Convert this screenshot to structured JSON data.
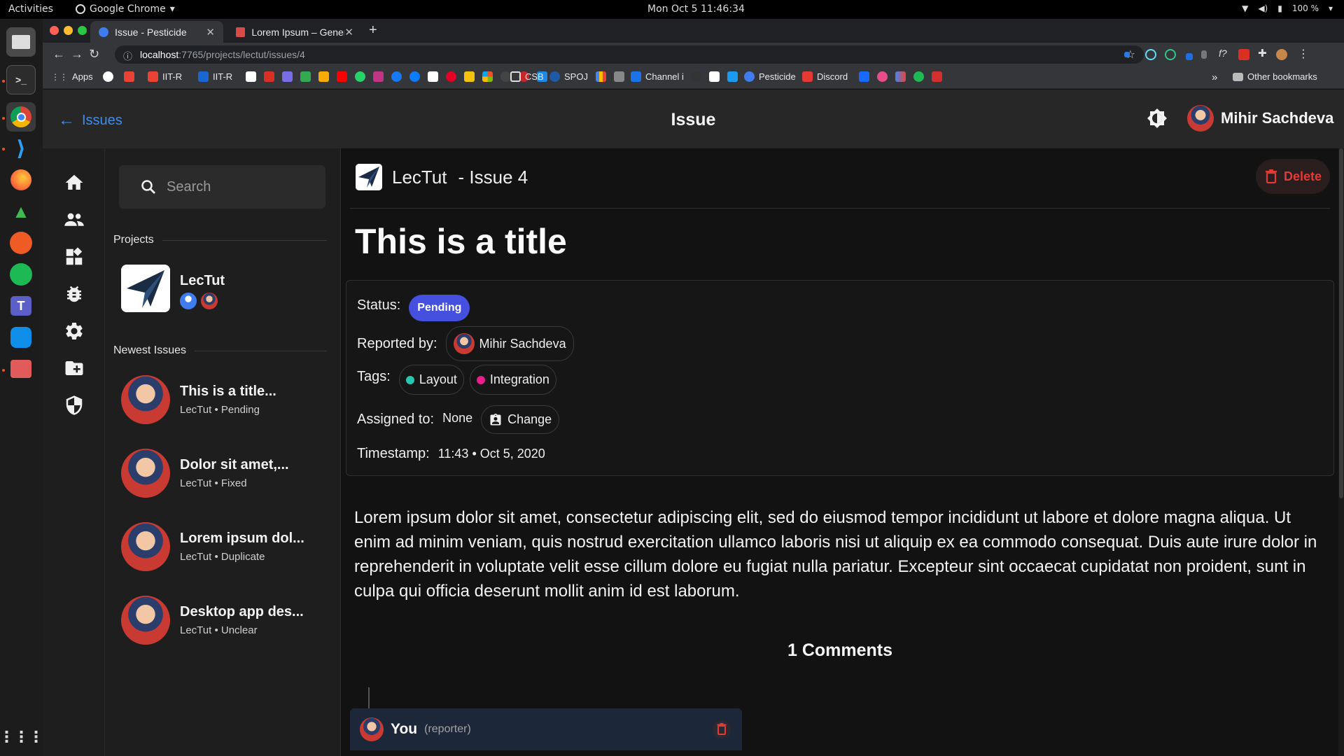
{
  "os": {
    "activities": "Activities",
    "app_name": "Google Chrome",
    "clock": "Mon Oct 5  11:46:34",
    "battery": "100 %"
  },
  "browser": {
    "tabs": [
      {
        "label": "Issue - Pesticide",
        "active": true
      },
      {
        "label": "Lorem Ipsum – Generator",
        "active": false
      }
    ],
    "url_host": "localhost",
    "url_path": ":7765/projects/lectut/issues/4",
    "bookmarks": [
      "Apps",
      "IIT-R",
      "IIT-R",
      "CSB",
      "SPOJ",
      "Channel i",
      "Pesticide",
      "Discord"
    ],
    "overflow": "»",
    "other_bookmarks": "Other bookmarks"
  },
  "header": {
    "back_label": "Issues",
    "page_title": "Issue",
    "user_name": "Mihir Sachdeva"
  },
  "sidebar": {
    "search_placeholder": "Search",
    "projects_heading": "Projects",
    "project": {
      "name": "LecTut"
    },
    "newest_heading": "Newest Issues",
    "issues": [
      {
        "title": "This is a title...",
        "subtitle": "LecTut • Pending"
      },
      {
        "title": "Dolor sit amet,...",
        "subtitle": "LecTut • Fixed"
      },
      {
        "title": "Lorem ipsum dol...",
        "subtitle": "LecTut • Duplicate"
      },
      {
        "title": "Desktop app des...",
        "subtitle": "LecTut • Unclear"
      }
    ]
  },
  "issue": {
    "project_name": "LecTut",
    "issue_number": "- Issue 4",
    "delete_label": "Delete",
    "title": "This is a title",
    "status_label": "Status:",
    "status_value": "Pending",
    "reported_label": "Reported by:",
    "reporter": "Mihir Sachdeva",
    "tags_label": "Tags:",
    "tags": [
      {
        "name": "Layout",
        "color": "#26c6b0"
      },
      {
        "name": "Integration",
        "color": "#e91e8c"
      }
    ],
    "assigned_label": "Assigned to:",
    "assigned_value": "None",
    "change_label": "Change",
    "timestamp_label": "Timestamp:",
    "timestamp_value": "11:43 • Oct 5, 2020",
    "description": "Lorem ipsum dolor sit amet, consectetur adipiscing elit, sed do eiusmod tempor incididunt ut labore et dolore magna aliqua. Ut enim ad minim veniam, quis nostrud exercitation ullamco laboris nisi ut aliquip ex ea commodo consequat. Duis aute irure dolor in reprehenderit in voluptate velit esse cillum dolore eu fugiat nulla pariatur. Excepteur sint occaecat cupidatat non proident, sunt in culpa qui officia deserunt mollit anim id est laborum.",
    "comments_title": "1 Comments",
    "comment": {
      "author": "You",
      "role": "(reporter)"
    }
  },
  "colors": {
    "accent": "#3f8cf0",
    "pending": "#4650df",
    "danger": "#e53935"
  }
}
